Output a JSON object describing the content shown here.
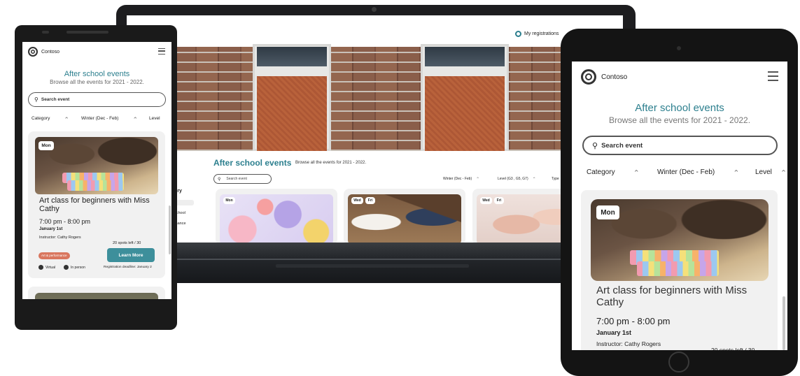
{
  "brand": {
    "name": "Contoso"
  },
  "page": {
    "title": "After school events",
    "subtitle": "Browse all the events for 2021 - 2022."
  },
  "search": {
    "placeholder": "Search event"
  },
  "filters": {
    "category": "Category",
    "season": "Winter (Dec - Feb)",
    "level": "Level",
    "level_laptop": "Level (G3 , G5, G7)",
    "type": "Type"
  },
  "laptop": {
    "header_link": "My registrations",
    "sidebar_fragments": [
      "ory",
      "school",
      "mance"
    ],
    "cards": [
      {
        "days": [
          "Mon"
        ]
      },
      {
        "days": [
          "Wed",
          "Fri"
        ]
      },
      {
        "days": [
          "Wed",
          "Fri"
        ]
      }
    ]
  },
  "event": {
    "day": "Mon",
    "title": "Art class for beginners with Miss Cathy",
    "time": "7:00 pm - 8:00 pm",
    "date": "January 1st",
    "instructor": "Instructor: Cathy Rogers",
    "spots": "20 spots left / 30",
    "category_tag": "Art & performance",
    "button": "Learn More",
    "mode_virtual": "Virtual",
    "mode_in_person": "In person",
    "deadline": "Registration deadline: January 2"
  },
  "colors": {
    "accent": "#2c7f8e",
    "button": "#3d8f9b",
    "tag": "#d9765e"
  }
}
